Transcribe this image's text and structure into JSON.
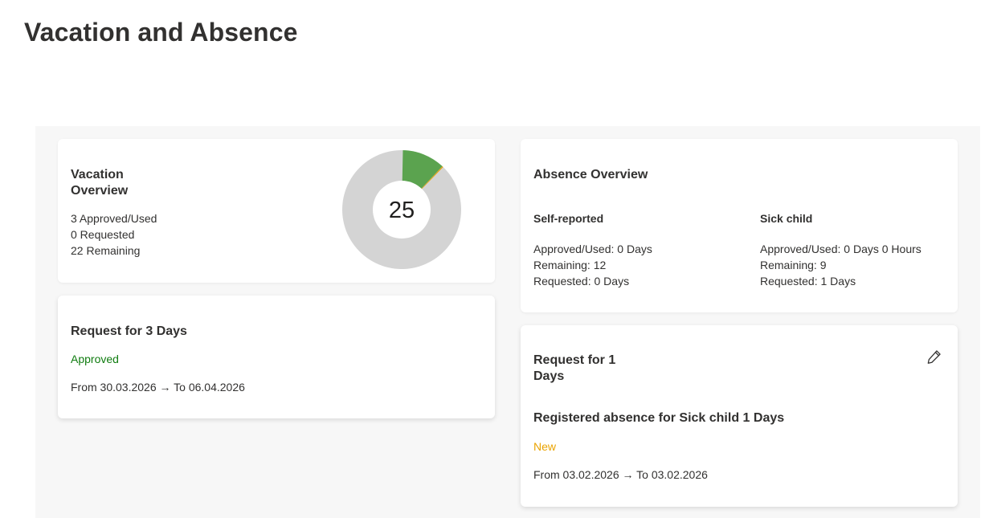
{
  "page": {
    "title": "Vacation and Absence"
  },
  "vacation_overview": {
    "title": "Vacation Overview",
    "stats": [
      "3 Approved/Used",
      "0 Requested",
      "22 Remaining"
    ],
    "donut": {
      "center_label": "25",
      "segments": [
        {
          "name": "Approved/Used",
          "value": 3,
          "color": "#5ba34f"
        },
        {
          "name": "Requested",
          "value": 0,
          "color": "#e3a21a"
        },
        {
          "name": "Remaining",
          "value": 22,
          "color": "#d4d4d4"
        }
      ]
    }
  },
  "vacation_request": {
    "title": "Request for 3 Days",
    "status": "Approved",
    "range": "From 30.03.2026 → To 06.04.2026"
  },
  "absence_overview": {
    "title": "Absence Overview",
    "self_reported": {
      "heading": "Self-reported",
      "lines": [
        "Approved/Used: 0 Days",
        "Remaining: 12",
        "Requested: 0 Days"
      ]
    },
    "sick_child": {
      "heading": "Sick child",
      "lines": [
        "Approved/Used: 0 Days 0 Hours",
        "Remaining: 9",
        "Requested: 1 Days"
      ]
    }
  },
  "absence_request": {
    "title": "Request for 1 Days",
    "description": "Registered absence for Sick child 1 Days",
    "status": "New",
    "range": "From 03.02.2026 → To 03.02.2026",
    "edit_icon": "pencil-icon"
  },
  "colors": {
    "approved": "#107c10",
    "new": "#eaa300",
    "donut_used": "#5ba34f",
    "donut_requested": "#e3a21a",
    "donut_remaining": "#d4d4d4"
  }
}
